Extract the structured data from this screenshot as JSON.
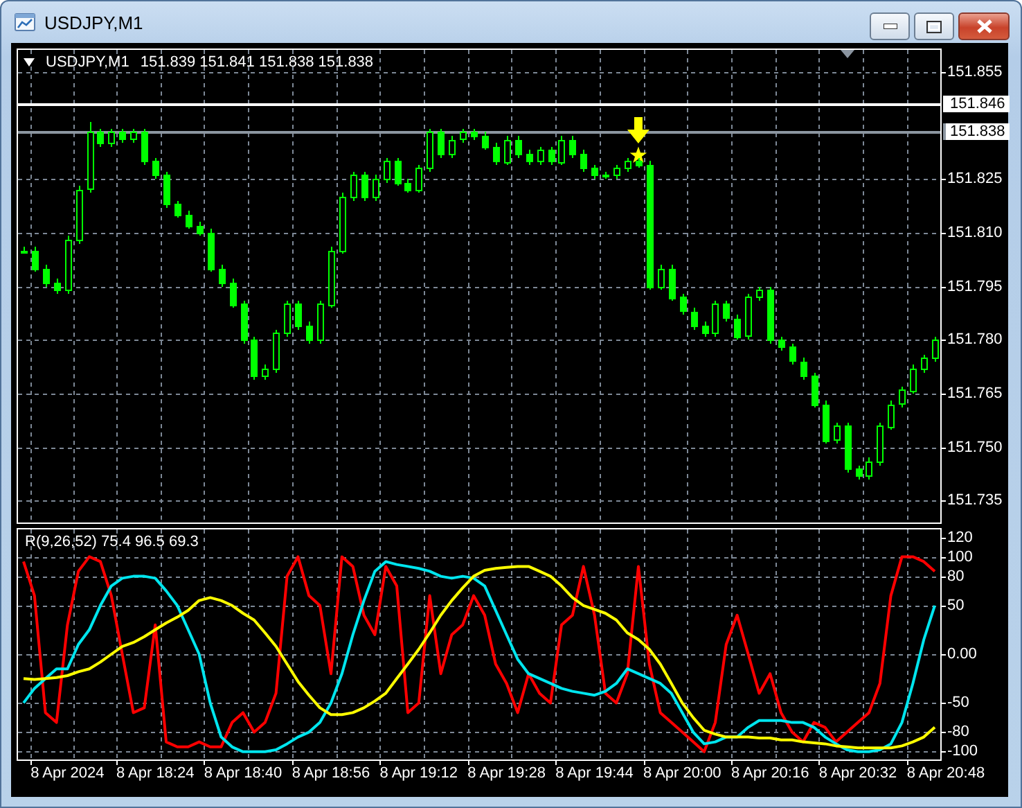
{
  "window": {
    "title": "USDJPY,M1"
  },
  "price_panel": {
    "symbol_label": "USDJPY,M1",
    "quotes": "151.839 151.841 151.838 151.838",
    "markers": [
      {
        "kind": "arrow",
        "color": "#ffff00"
      },
      {
        "kind": "star",
        "color": "#ffff00"
      }
    ],
    "chart_data": {
      "type": "candlestick",
      "grid": true,
      "ylim": [
        151.729,
        151.861
      ],
      "ref_lines": [
        {
          "axis": "y",
          "value": 151.846,
          "label": "151.846",
          "color": "#ffffff"
        },
        {
          "axis": "y",
          "value": 151.838,
          "label": "151.838",
          "color": "#8c96a0"
        }
      ],
      "categories": [
        null,
        null,
        null,
        null,
        null,
        null,
        null,
        null,
        null,
        null,
        null,
        null,
        null,
        null,
        null,
        null,
        null,
        null,
        null,
        null,
        null,
        null,
        null,
        null,
        null,
        null,
        null,
        null,
        null,
        null,
        null,
        null,
        null,
        null,
        null,
        null,
        null,
        null,
        null,
        null,
        null,
        null,
        null,
        null,
        null,
        null,
        null,
        null,
        null,
        null,
        null,
        null,
        null,
        null,
        null,
        null,
        null,
        null,
        null,
        null,
        null,
        null,
        null,
        null,
        null,
        null,
        null,
        null,
        null,
        null,
        null,
        null,
        null,
        null,
        null,
        null,
        null,
        null,
        null,
        null,
        null,
        null,
        null,
        null
      ],
      "yticks": [
        {
          "value": 151.735,
          "label": "151.735"
        },
        {
          "value": 151.75,
          "label": "151.750"
        },
        {
          "value": 151.765,
          "label": "151.765"
        },
        {
          "value": 151.78,
          "label": "151.780"
        },
        {
          "value": 151.795,
          "label": "151.795"
        },
        {
          "value": 151.81,
          "label": "151.810"
        },
        {
          "value": 151.825,
          "label": "151.825"
        },
        {
          "value": 151.855,
          "label": "151.855"
        }
      ],
      "ohlc": [
        [
          151.805,
          151.806,
          151.804,
          151.805
        ],
        [
          151.805,
          151.806,
          151.799,
          151.8
        ],
        [
          151.8,
          151.801,
          151.795,
          151.796
        ],
        [
          151.796,
          151.797,
          151.793,
          151.794
        ],
        [
          151.794,
          151.809,
          151.793,
          151.808
        ],
        [
          151.808,
          151.823,
          151.807,
          151.822
        ],
        [
          151.822,
          151.841,
          151.821,
          151.838
        ],
        [
          151.838,
          151.839,
          151.834,
          151.835
        ],
        [
          151.835,
          151.839,
          151.834,
          151.838
        ],
        [
          151.838,
          151.839,
          151.835,
          151.836
        ],
        [
          151.836,
          151.839,
          151.835,
          151.838
        ],
        [
          151.838,
          151.839,
          151.829,
          151.83
        ],
        [
          151.83,
          151.831,
          151.825,
          151.826
        ],
        [
          151.826,
          151.827,
          151.817,
          151.818
        ],
        [
          151.818,
          151.819,
          151.814,
          151.815
        ],
        [
          151.815,
          151.816,
          151.811,
          151.812
        ],
        [
          151.812,
          151.813,
          151.809,
          151.81
        ],
        [
          151.81,
          151.811,
          151.799,
          151.8
        ],
        [
          151.8,
          151.801,
          151.795,
          151.796
        ],
        [
          151.796,
          151.797,
          151.789,
          151.79
        ],
        [
          151.79,
          151.791,
          151.779,
          151.78
        ],
        [
          151.78,
          151.781,
          151.769,
          151.77
        ],
        [
          151.77,
          151.773,
          151.769,
          151.772
        ],
        [
          151.772,
          151.783,
          151.771,
          151.782
        ],
        [
          151.782,
          151.791,
          151.781,
          151.79
        ],
        [
          151.79,
          151.791,
          151.783,
          151.784
        ],
        [
          151.784,
          151.785,
          151.779,
          151.78
        ],
        [
          151.78,
          151.791,
          151.779,
          151.79
        ],
        [
          151.79,
          151.806,
          151.789,
          151.805
        ],
        [
          151.805,
          151.821,
          151.804,
          151.82
        ],
        [
          151.82,
          151.827,
          151.819,
          151.826
        ],
        [
          151.826,
          151.827,
          151.819,
          151.82
        ],
        [
          151.82,
          151.826,
          151.819,
          151.825
        ],
        [
          151.825,
          151.831,
          151.824,
          151.83
        ],
        [
          151.83,
          151.831,
          151.823,
          151.824
        ],
        [
          151.824,
          151.825,
          151.821,
          151.822
        ],
        [
          151.822,
          151.829,
          151.821,
          151.828
        ],
        [
          151.828,
          151.839,
          151.827,
          151.838
        ],
        [
          151.838,
          151.839,
          151.831,
          151.832
        ],
        [
          151.832,
          151.837,
          151.831,
          151.836
        ],
        [
          151.836,
          151.839,
          151.835,
          151.838
        ],
        [
          151.838,
          151.839,
          151.836,
          151.837
        ],
        [
          151.837,
          151.838,
          151.833,
          151.834
        ],
        [
          151.834,
          151.835,
          151.829,
          151.83
        ],
        [
          151.83,
          151.837,
          151.829,
          151.836
        ],
        [
          151.836,
          151.837,
          151.831,
          151.832
        ],
        [
          151.832,
          151.833,
          151.829,
          151.83
        ],
        [
          151.83,
          151.834,
          151.829,
          151.833
        ],
        [
          151.833,
          151.834,
          151.829,
          151.83
        ],
        [
          151.83,
          151.837,
          151.829,
          151.836
        ],
        [
          151.836,
          151.837,
          151.831,
          151.832
        ],
        [
          151.832,
          151.833,
          151.827,
          151.828
        ],
        [
          151.828,
          151.829,
          151.825,
          151.826
        ],
        [
          151.826,
          151.827,
          151.825,
          151.826
        ],
        [
          151.826,
          151.829,
          151.825,
          151.828
        ],
        [
          151.828,
          151.831,
          151.827,
          151.83
        ],
        [
          151.83,
          151.831,
          151.828,
          151.829
        ],
        [
          151.829,
          151.83,
          151.794,
          151.795
        ],
        [
          151.795,
          151.801,
          151.794,
          151.8
        ],
        [
          151.8,
          151.801,
          151.791,
          151.792
        ],
        [
          151.792,
          151.793,
          151.787,
          151.788
        ],
        [
          151.788,
          151.789,
          151.783,
          151.784
        ],
        [
          151.784,
          151.785,
          151.781,
          151.782
        ],
        [
          151.782,
          151.791,
          151.781,
          151.79
        ],
        [
          151.79,
          151.791,
          151.785,
          151.786
        ],
        [
          151.786,
          151.787,
          151.78,
          151.781
        ],
        [
          151.781,
          151.793,
          151.78,
          151.792
        ],
        [
          151.792,
          151.795,
          151.791,
          151.794
        ],
        [
          151.794,
          151.795,
          151.779,
          151.78
        ],
        [
          151.78,
          151.781,
          151.777,
          151.778
        ],
        [
          151.778,
          151.779,
          151.773,
          151.774
        ],
        [
          151.774,
          151.775,
          151.769,
          151.77
        ],
        [
          151.77,
          151.771,
          151.761,
          151.762
        ],
        [
          151.762,
          151.763,
          151.751,
          151.752
        ],
        [
          151.752,
          151.757,
          151.751,
          151.756
        ],
        [
          151.756,
          151.757,
          151.743,
          151.744
        ],
        [
          151.744,
          151.745,
          151.741,
          151.742
        ],
        [
          151.742,
          151.747,
          151.741,
          151.746
        ],
        [
          151.746,
          151.757,
          151.745,
          151.756
        ],
        [
          151.756,
          151.763,
          151.755,
          151.762
        ],
        [
          151.762,
          151.767,
          151.761,
          151.766
        ],
        [
          151.766,
          151.773,
          151.765,
          151.772
        ],
        [
          151.772,
          151.776,
          151.771,
          151.775
        ],
        [
          151.775,
          151.781,
          151.774,
          151.78
        ]
      ]
    }
  },
  "indicator_panel": {
    "label": "R(9,26,52) 75.4 96.5 69.3",
    "chart_data": {
      "type": "line",
      "grid": true,
      "ylim": [
        -108,
        128
      ],
      "categories": [
        null,
        null,
        null,
        null,
        "8 Apr 2024",
        null,
        null,
        null,
        null,
        null,
        null,
        null,
        "8 Apr 18:24",
        null,
        null,
        null,
        null,
        null,
        null,
        null,
        "8 Apr 18:40",
        null,
        null,
        null,
        null,
        null,
        null,
        null,
        "8 Apr 18:56",
        null,
        null,
        null,
        null,
        null,
        null,
        null,
        "8 Apr 19:12",
        null,
        null,
        null,
        null,
        null,
        null,
        null,
        "8 Apr 19:28",
        null,
        null,
        null,
        null,
        null,
        null,
        null,
        "8 Apr 19:44",
        null,
        null,
        null,
        null,
        null,
        null,
        null,
        "8 Apr 20:00",
        null,
        null,
        null,
        null,
        null,
        null,
        null,
        "8 Apr 20:16",
        null,
        null,
        null,
        null,
        null,
        null,
        null,
        "8 Apr 20:32",
        null,
        null,
        null,
        null,
        null,
        null,
        null,
        "8 Apr 20:48"
      ],
      "yticks": [
        {
          "value": 120,
          "label": "120"
        },
        {
          "value": 100,
          "label": "100"
        },
        {
          "value": 80,
          "label": "80"
        },
        {
          "value": 50,
          "label": "50"
        },
        {
          "value": 0,
          "label": "0.00"
        },
        {
          "value": -50,
          "label": "-50"
        },
        {
          "value": -80,
          "label": "-80"
        },
        {
          "value": -100,
          "label": "-100"
        }
      ],
      "series": [
        {
          "color": "#ff0000",
          "values": [
            95,
            60,
            -60,
            -70,
            30,
            85,
            100,
            95,
            60,
            0,
            -60,
            -55,
            30,
            -90,
            -95,
            -95,
            -90,
            -95,
            -95,
            -70,
            -60,
            -80,
            -70,
            -40,
            80,
            100,
            60,
            50,
            -20,
            100,
            90,
            40,
            20,
            90,
            70,
            -60,
            -50,
            60,
            -20,
            20,
            30,
            60,
            40,
            -10,
            -30,
            -60,
            -20,
            -40,
            -50,
            30,
            40,
            90,
            40,
            -40,
            -50,
            -20,
            90,
            -10,
            -60,
            -70,
            -80,
            -90,
            -100,
            -70,
            10,
            40,
            0,
            -40,
            -20,
            -60,
            -80,
            -90,
            -70,
            -75,
            -90,
            -80,
            -70,
            -60,
            -30,
            60,
            100,
            100,
            95,
            85,
            null
          ]
        },
        {
          "color": "#00e5ee",
          "values": [
            -50,
            -35,
            -25,
            -15,
            -15,
            10,
            25,
            50,
            70,
            78,
            80,
            80,
            78,
            65,
            50,
            25,
            0,
            -50,
            -85,
            -95,
            -100,
            -100,
            -100,
            -98,
            -92,
            -85,
            -80,
            -70,
            -50,
            -20,
            20,
            55,
            85,
            95,
            92,
            90,
            88,
            85,
            80,
            78,
            80,
            78,
            70,
            45,
            20,
            -5,
            -20,
            -25,
            -30,
            -35,
            -38,
            -40,
            -42,
            -38,
            -30,
            -15,
            -20,
            -25,
            -30,
            -40,
            -60,
            -80,
            -92,
            -90,
            -85,
            -85,
            -75,
            -68,
            -68,
            -68,
            -70,
            -70,
            -75,
            -85,
            -92,
            -98,
            -100,
            -100,
            -98,
            -92,
            -70,
            -30,
            15,
            50,
            null
          ]
        },
        {
          "color": "#ffff00",
          "values": [
            -25,
            -26,
            -25,
            -24,
            -22,
            -18,
            -15,
            -8,
            0,
            8,
            12,
            18,
            25,
            32,
            38,
            45,
            55,
            58,
            55,
            50,
            42,
            35,
            22,
            8,
            -10,
            -28,
            -42,
            -55,
            -62,
            -62,
            -60,
            -55,
            -48,
            -40,
            -25,
            -10,
            5,
            22,
            40,
            55,
            68,
            80,
            86,
            88,
            89,
            90,
            90,
            85,
            80,
            70,
            58,
            50,
            46,
            42,
            35,
            22,
            15,
            5,
            -10,
            -30,
            -50,
            -65,
            -78,
            -82,
            -85,
            -85,
            -85,
            -86,
            -86,
            -88,
            -88,
            -90,
            -91,
            -92,
            -94,
            -95,
            -96,
            -96,
            -96,
            -96,
            -94,
            -90,
            -85,
            -75,
            null
          ]
        }
      ]
    }
  }
}
